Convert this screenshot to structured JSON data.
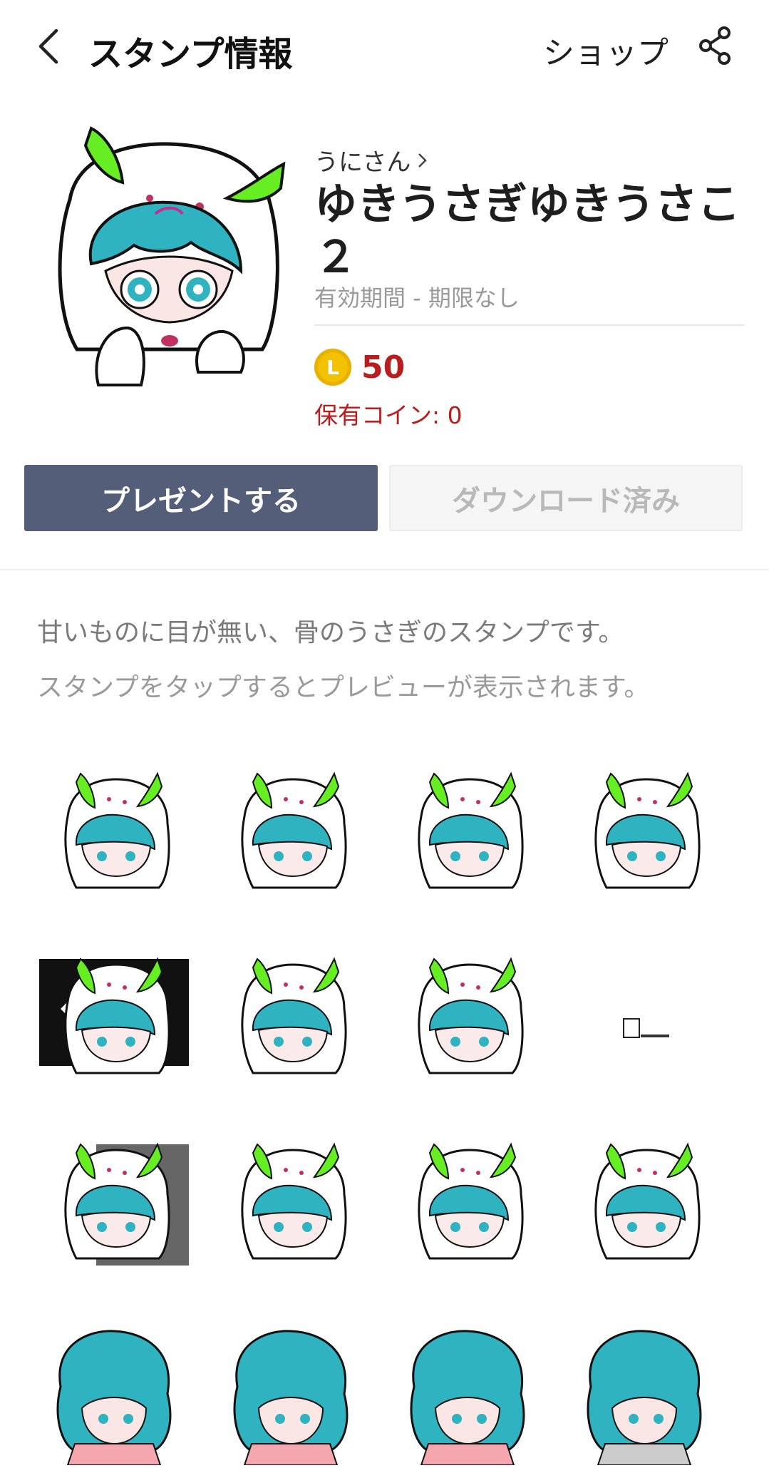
{
  "header": {
    "title": "スタンプ情報",
    "shop_label": "ショップ"
  },
  "pack": {
    "author": "うにさん",
    "name": "ゆきうさぎゆきうさこ２",
    "validity": "有効期間 - 期限なし",
    "coin_icon_letter": "L",
    "price": "50",
    "owned_coins": "保有コイン: 0"
  },
  "actions": {
    "present_label": "プレゼントする",
    "downloaded_label": "ダウンロード済み"
  },
  "description": {
    "text": "甘いものに目が無い、骨のうさぎのスタンプです。",
    "hint": "スタンプをタップするとプレビューが表示されます。"
  },
  "colors": {
    "accent_button": "#545e78",
    "price_red": "#b81e1e",
    "coin_yellow": "#f2c200",
    "ear_green": "#66ee22",
    "hair_teal": "#2fb3c0"
  },
  "sticker_count": 16
}
